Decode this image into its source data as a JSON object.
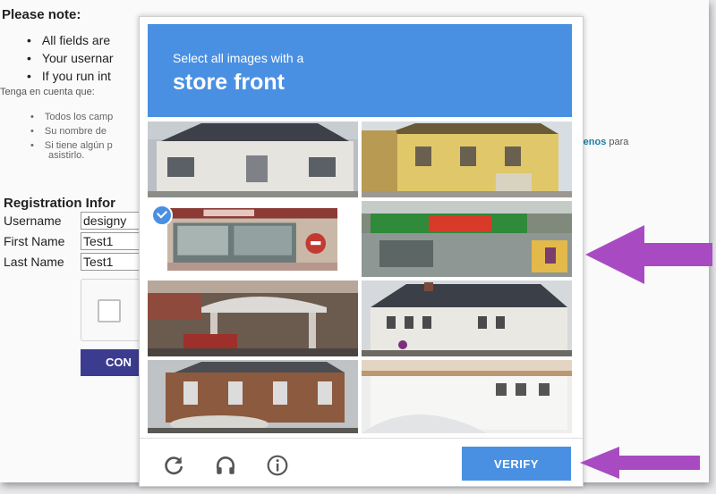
{
  "background_form": {
    "note_title": "Please note:",
    "notes_en": [
      "All fields are",
      "Your usernar",
      "If you run int"
    ],
    "note_title_es": "Tenga en cuenta que:",
    "notes_es": [
      "Todos los camp",
      "Su nombre de",
      "Si tiene algún p"
    ],
    "notes_es_continuation": "asistirlo.",
    "contact_link": "tenos",
    "contact_suffix": "para",
    "registration_title": "Registration Infor",
    "fields": [
      {
        "label": "Username",
        "value": "designy"
      },
      {
        "label": "First Name",
        "value": "Test1"
      },
      {
        "label": "Last Name",
        "value": "Test1"
      }
    ],
    "continue_label": "CON"
  },
  "captcha": {
    "instruction_line1": "Select all images with a",
    "instruction_target": "store front",
    "tiles": [
      {
        "description": "white cottage",
        "selected": false
      },
      {
        "description": "yellow building",
        "selected": false
      },
      {
        "description": "storefront window",
        "selected": true
      },
      {
        "description": "shop with green sign",
        "selected": false
      },
      {
        "description": "petrol station canopy",
        "selected": false
      },
      {
        "description": "white terraced house",
        "selected": false
      },
      {
        "description": "brick building",
        "selected": false
      },
      {
        "description": "white house",
        "selected": false
      }
    ],
    "reload_icon": "reload-icon",
    "audio_icon": "headphones-icon",
    "info_icon": "info-icon",
    "verify_label": "VERIFY"
  },
  "annotations": {
    "arrow_color": "#a84bc2",
    "accent_color": "#4a90e2"
  }
}
